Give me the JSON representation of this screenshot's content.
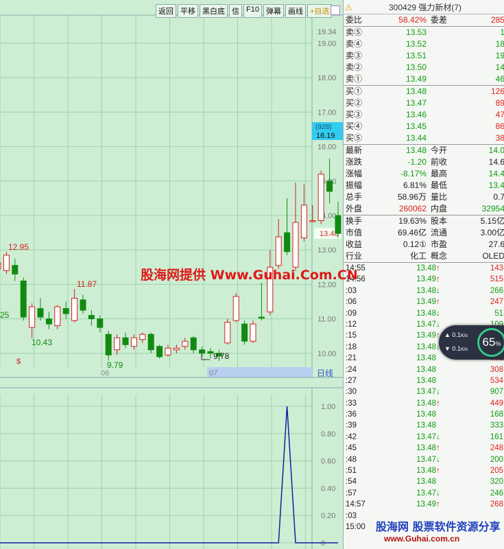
{
  "toolbar": {
    "buttons": [
      "返回",
      "平移",
      "黑白底",
      "信",
      "F10",
      "弹幕",
      "画线"
    ],
    "star": "+自选"
  },
  "price_axis": {
    "labels": [
      "19.34",
      "19.00",
      "18.00",
      "17.00",
      "16.00",
      "15.00",
      "14.00",
      "13.00",
      "12.00",
      "11.00",
      "10.00"
    ],
    "crosshair_top": "(928)",
    "crosshair_value": "16.19",
    "current_price_label": "13.48"
  },
  "chart_labels": {
    "high_1": "12.95",
    "high_2": "11.87",
    "low_1": "10.43",
    "low_2": "9.79",
    "low_3": "9.78",
    "left_cut": "25",
    "month_06": "06",
    "month_07": "07",
    "period": "日线",
    "s_mark": "$"
  },
  "chart_data": {
    "type": "candlestick",
    "ylim": [
      9.6,
      19.4
    ],
    "candles": [
      {
        "o": 12.45,
        "c": 12.62,
        "h": 12.7,
        "l": 12.3
      },
      {
        "o": 12.4,
        "c": 12.85,
        "h": 12.95,
        "l": 12.3
      },
      {
        "o": 12.55,
        "c": 12.3,
        "h": 12.75,
        "l": 12.1
      },
      {
        "o": 12.1,
        "c": 11.05,
        "h": 12.2,
        "l": 10.95
      },
      {
        "o": 10.75,
        "c": 11.35,
        "h": 11.45,
        "l": 10.43
      },
      {
        "o": 11.3,
        "c": 11.05,
        "h": 11.6,
        "l": 10.95
      },
      {
        "o": 11.0,
        "c": 10.85,
        "h": 11.2,
        "l": 10.7
      },
      {
        "o": 10.8,
        "c": 11.35,
        "h": 11.4,
        "l": 10.7
      },
      {
        "o": 11.3,
        "c": 11.15,
        "h": 11.5,
        "l": 11.0
      },
      {
        "o": 10.95,
        "c": 11.6,
        "h": 11.87,
        "l": 10.9
      },
      {
        "o": 11.55,
        "c": 11.25,
        "h": 11.7,
        "l": 11.15
      },
      {
        "o": 11.1,
        "c": 11.0,
        "h": 11.25,
        "l": 10.8
      },
      {
        "o": 11.0,
        "c": 10.75,
        "h": 11.1,
        "l": 10.6
      },
      {
        "o": 10.55,
        "c": 9.95,
        "h": 10.65,
        "l": 9.79
      },
      {
        "o": 10.1,
        "c": 10.45,
        "h": 10.55,
        "l": 9.95
      },
      {
        "o": 10.45,
        "c": 10.25,
        "h": 10.6,
        "l": 10.15
      },
      {
        "o": 10.2,
        "c": 10.45,
        "h": 10.55,
        "l": 10.1
      },
      {
        "o": 10.4,
        "c": 10.55,
        "h": 10.6,
        "l": 10.3
      },
      {
        "o": 10.55,
        "c": 10.1,
        "h": 10.6,
        "l": 10.0
      },
      {
        "o": 10.2,
        "c": 9.9,
        "h": 10.25,
        "l": 9.85
      },
      {
        "o": 9.95,
        "c": 10.15,
        "h": 10.25,
        "l": 9.9
      },
      {
        "o": 10.1,
        "c": 10.15,
        "h": 10.25,
        "l": 10.0
      },
      {
        "o": 10.2,
        "c": 10.35,
        "h": 10.45,
        "l": 10.1
      },
      {
        "o": 10.45,
        "c": 10.1,
        "h": 10.5,
        "l": 10.0
      },
      {
        "o": 10.1,
        "c": 10.0,
        "h": 10.2,
        "l": 9.9
      },
      {
        "o": 10.05,
        "c": 10.0,
        "h": 10.15,
        "l": 9.85
      },
      {
        "o": 10.0,
        "c": 9.92,
        "h": 10.1,
        "l": 9.78
      },
      {
        "o": 10.3,
        "c": 10.9,
        "h": 11.0,
        "l": 10.25
      },
      {
        "o": 10.95,
        "c": 11.65,
        "h": 11.75,
        "l": 10.9
      },
      {
        "o": 10.85,
        "c": 10.35,
        "h": 10.95,
        "l": 10.25
      },
      {
        "o": 10.35,
        "c": 10.85,
        "h": 10.95,
        "l": 10.3
      },
      {
        "o": 11.05,
        "c": 11.02,
        "h": 12.05,
        "l": 10.95
      },
      {
        "o": 11.2,
        "c": 12.5,
        "h": 13.0,
        "l": 11.1
      },
      {
        "o": 12.55,
        "c": 13.38,
        "h": 13.9,
        "l": 12.45
      },
      {
        "o": 13.5,
        "c": 12.95,
        "h": 14.5,
        "l": 12.85
      },
      {
        "o": 12.5,
        "c": 13.8,
        "h": 14.95,
        "l": 12.4
      },
      {
        "o": 13.35,
        "c": 14.3,
        "h": 14.9,
        "l": 13.25
      },
      {
        "o": 13.85,
        "c": 13.85,
        "h": 14.3,
        "l": 13.8
      },
      {
        "o": 13.85,
        "c": 15.2,
        "h": 15.3,
        "l": 13.75
      },
      {
        "o": 15.0,
        "c": 14.7,
        "h": 15.65,
        "l": 14.35
      },
      {
        "o": 14.0,
        "c": 13.48,
        "h": 14.4,
        "l": 13.35
      }
    ],
    "indicator": {
      "ylim": [
        0,
        1.0
      ],
      "axis_labels": [
        "1.00",
        "0.80",
        "0.60",
        "0.40",
        "0.20",
        "0"
      ],
      "values_note": "",
      "values": [
        0,
        0,
        0,
        0,
        0,
        0,
        0,
        0,
        0,
        0,
        0,
        0,
        0,
        0,
        0,
        0,
        0,
        0,
        0,
        0,
        0,
        0,
        0,
        0,
        0,
        0,
        0,
        0,
        0,
        0,
        0,
        0,
        0,
        0,
        1,
        0,
        0,
        0,
        0,
        0,
        0
      ]
    }
  },
  "quote": {
    "code_name": "300429 强力新材(7)",
    "webi_label": "委比",
    "webi_value": "58.42%",
    "weicha_label": "委差",
    "weicha_value": "285",
    "asks": [
      {
        "label": "卖⑤",
        "price": "13.53",
        "vol": "1"
      },
      {
        "label": "卖④",
        "price": "13.52",
        "vol": "18"
      },
      {
        "label": "卖③",
        "price": "13.51",
        "vol": "19"
      },
      {
        "label": "卖②",
        "price": "13.50",
        "vol": "14"
      },
      {
        "label": "卖①",
        "price": "13.49",
        "vol": "46"
      }
    ],
    "bids": [
      {
        "label": "买①",
        "price": "13.48",
        "vol": "126"
      },
      {
        "label": "买②",
        "price": "13.47",
        "vol": "89"
      },
      {
        "label": "买③",
        "price": "13.46",
        "vol": "47"
      },
      {
        "label": "买④",
        "price": "13.45",
        "vol": "86"
      },
      {
        "label": "买⑤",
        "price": "13.44",
        "vol": "38"
      }
    ],
    "stats": [
      {
        "l1": "最新",
        "v1": "13.48",
        "c1": "green",
        "l2": "今开",
        "v2": "14.0",
        "c2": "green"
      },
      {
        "l1": "涨跌",
        "v1": "-1.20",
        "c1": "green",
        "l2": "前收",
        "v2": "14.6",
        "c2": "dark"
      },
      {
        "l1": "涨幅",
        "v1": "-8.17%",
        "c1": "green",
        "l2": "最高",
        "v2": "14.4",
        "c2": "green"
      },
      {
        "l1": "振幅",
        "v1": "6.81%",
        "c1": "dark",
        "l2": "最低",
        "v2": "13.4",
        "c2": "green"
      },
      {
        "l1": "总手",
        "v1": "58.96万",
        "c1": "dark",
        "l2": "量比",
        "v2": "0.7",
        "c2": "dark"
      },
      {
        "l1": "外盘",
        "v1": "260062",
        "c1": "red",
        "l2": "内盘",
        "v2": "32954",
        "c2": "green"
      }
    ],
    "stats2": [
      {
        "l1": "换手",
        "v1": "19.63%",
        "l2": "股本",
        "v2": "5.15亿"
      },
      {
        "l1": "市值",
        "v1": "69.46亿",
        "l2": "流通",
        "v2": "3.00亿"
      },
      {
        "l1": "收益",
        "v1": "0.12①",
        "l2": "市盈",
        "v2": "27.6"
      },
      {
        "l1": "行业",
        "v1": "化工",
        "l2": "概念",
        "v2": "OLED"
      }
    ],
    "ticks": [
      {
        "t": "14:55",
        "p": "13.48",
        "a": "↑",
        "v": "143",
        "pc": "green",
        "vc": "red"
      },
      {
        "t": "14:56",
        "p": "13.49",
        "a": "↑",
        "v": "515",
        "pc": "green",
        "vc": "red"
      },
      {
        "t": ":03",
        "p": "13.48",
        "a": "↓",
        "v": "266",
        "pc": "green",
        "vc": "green"
      },
      {
        "t": ":06",
        "p": "13.49",
        "a": "↑",
        "v": "247",
        "pc": "green",
        "vc": "red"
      },
      {
        "t": ":09",
        "p": "13.48",
        "a": "↓",
        "v": "51",
        "pc": "green",
        "vc": "green"
      },
      {
        "t": ":12",
        "p": "13.47",
        "a": "↓",
        "v": "109",
        "pc": "green",
        "vc": "green"
      },
      {
        "t": ":15",
        "p": "13.49",
        "a": "↑",
        "v": "",
        "pc": "green",
        "vc": "red"
      },
      {
        "t": ":18",
        "p": "13.48",
        "a": "↓",
        "v": "",
        "pc": "green",
        "vc": "green"
      },
      {
        "t": ":21",
        "p": "13.48",
        "a": "",
        "v": "651",
        "pc": "green",
        "vc": "red"
      },
      {
        "t": ":24",
        "p": "13.48",
        "a": "",
        "v": "308",
        "pc": "green",
        "vc": "red"
      },
      {
        "t": ":27",
        "p": "13.48",
        "a": "",
        "v": "534",
        "pc": "green",
        "vc": "red"
      },
      {
        "t": ":30",
        "p": "13.47",
        "a": "↓",
        "v": "907",
        "pc": "green",
        "vc": "green"
      },
      {
        "t": ":33",
        "p": "13.48",
        "a": "↑",
        "v": "449",
        "pc": "green",
        "vc": "red"
      },
      {
        "t": ":36",
        "p": "13.48",
        "a": "",
        "v": "168",
        "pc": "green",
        "vc": "green"
      },
      {
        "t": ":39",
        "p": "13.48",
        "a": "",
        "v": "333",
        "pc": "green",
        "vc": "green"
      },
      {
        "t": ":42",
        "p": "13.47",
        "a": "↓",
        "v": "161",
        "pc": "green",
        "vc": "green"
      },
      {
        "t": ":45",
        "p": "13.48",
        "a": "↑",
        "v": "248",
        "pc": "green",
        "vc": "red"
      },
      {
        "t": ":48",
        "p": "13.47",
        "a": "↓",
        "v": "200",
        "pc": "green",
        "vc": "green"
      },
      {
        "t": ":51",
        "p": "13.48",
        "a": "↑",
        "v": "205",
        "pc": "green",
        "vc": "red"
      },
      {
        "t": ":54",
        "p": "13.48",
        "a": "",
        "v": "320",
        "pc": "green",
        "vc": "green"
      },
      {
        "t": ":57",
        "p": "13.47",
        "a": "↓",
        "v": "246",
        "pc": "green",
        "vc": "green"
      },
      {
        "t": "14:57",
        "p": "13.49",
        "a": "↑",
        "v": "268",
        "pc": "green",
        "vc": "red"
      },
      {
        "t": ":03",
        "p": "",
        "a": "",
        "v": "",
        "pc": "green",
        "vc": "red"
      },
      {
        "t": "15:00",
        "p": "",
        "a": "",
        "v": "",
        "pc": "green",
        "vc": "red"
      }
    ]
  },
  "speed": {
    "up": "0.1",
    "down": "0.1",
    "unit": "K/s",
    "percent": "65",
    "pct_sign": "%"
  },
  "watermark": {
    "line1": "股海网提供 Www.Guhai.Com.CN",
    "line2": "股海网 股票软件资源分享",
    "line3": "www.Guhai.com.cn"
  }
}
